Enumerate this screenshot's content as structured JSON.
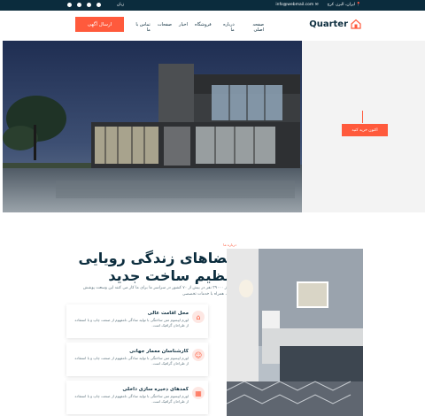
{
  "topbar": {
    "lang": "زبان",
    "social": [
      "facebook-icon",
      "twitter-icon",
      "instagram-icon",
      "dribbble-icon"
    ],
    "address": "📍 ایران، البرز، کرج",
    "email": "✉ info@webmail.com"
  },
  "header": {
    "cta_label": "ارسال آگهی",
    "nav": [
      "صفحه اصلی",
      "درباره ما",
      "فروشگاه",
      "اخبار",
      "صفحات",
      "تماس با ما"
    ],
    "logo_text": "Quarter"
  },
  "hero": {
    "buy_label": "اکنون خرید کنید"
  },
  "about": {
    "eyebrow": "درباره ما",
    "title": "فضاهای زندگی رویایی تنظیم ساخت جدید",
    "paragraph": "بیش از ۳۹۰۰۰ نفر در بیش از ۷۰ کشور در سراسر ما برای ما کار می کنند این وسعت پوشش جهانی، همراه با خدمات تخصصی",
    "cards": [
      {
        "title": "محل اقامت عالی",
        "desc": "لورم ایپسوم متن ساختگی با تولید سادگی نامفهوم از صنعت چاپ و با استفاده از طراحان گرافیک است."
      },
      {
        "title": "کارشناسان معمار جهانی",
        "desc": "لورم ایپسوم متن ساختگی با تولید سادگی نامفهوم از صنعت چاپ و با استفاده از طراحان گرافیک است."
      },
      {
        "title": "کمدهای ذخیره سازی داخلی",
        "desc": "لورم ایپسوم متن ساختگی با تولید سادگی نامفهوم از صنعت چاپ و با استفاده از طراحان گرافیک است."
      }
    ]
  },
  "colors": {
    "accent": "#ff5a3c",
    "navy": "#0b2c3d"
  }
}
